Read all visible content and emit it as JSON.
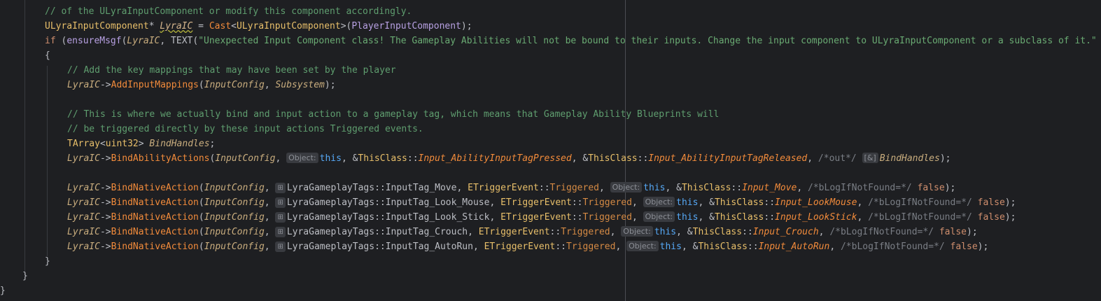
{
  "editor": {
    "theme": "dark"
  },
  "colors": {
    "default": "#bcbec4",
    "keyword": "#cf8e6d",
    "type": "#e8bf6a",
    "macro": "#b8a1e3",
    "string": "#6aab73",
    "comment": "#7a7e85",
    "green_comment": "#5f9e6f",
    "var_italic": "#d4b48c",
    "function": "#f28b3b",
    "param_italic": "#c9ad7e",
    "this": "#56a8f5",
    "enum_member": "#c77dbb",
    "orange": "#d58a44"
  },
  "lines": [
    {
      "indent": 64,
      "tokens": [
        {
          "t": "// of the ULyraInputComponent or modify this component accordingly.",
          "c": "green_comment"
        }
      ]
    },
    {
      "indent": 64,
      "tokens": [
        {
          "t": "ULyraInputComponent",
          "c": "type"
        },
        {
          "t": "* ",
          "c": "default"
        },
        {
          "t": "LyraIC",
          "c": "var_italic",
          "i": true,
          "u": true
        },
        {
          "t": " = ",
          "c": "default"
        },
        {
          "t": "Cast",
          "c": "function"
        },
        {
          "t": "<",
          "c": "default"
        },
        {
          "t": "ULyraInputComponent",
          "c": "type"
        },
        {
          "t": ">(",
          "c": "default"
        },
        {
          "t": "PlayerInputComponent",
          "c": "macro"
        },
        {
          "t": ");",
          "c": "default"
        }
      ]
    },
    {
      "indent": 64,
      "tokens": [
        {
          "t": "if",
          "c": "keyword"
        },
        {
          "t": " (",
          "c": "default"
        },
        {
          "t": "ensureMsgf",
          "c": "macro"
        },
        {
          "t": "(",
          "c": "default"
        },
        {
          "t": "LyraIC",
          "c": "param_italic",
          "i": true
        },
        {
          "t": ", ",
          "c": "default"
        },
        {
          "t": "TEXT",
          "c": "default"
        },
        {
          "t": "(",
          "c": "default"
        },
        {
          "t": "\"Unexpected Input Component class! The Gameplay Abilities will not be bound to their inputs. Change the input component to ULyraInputComponent or a subclass of it.\"",
          "c": "string"
        }
      ]
    },
    {
      "indent": 64,
      "tokens": [
        {
          "t": "{",
          "c": "default"
        }
      ]
    },
    {
      "indent": 96,
      "tokens": [
        {
          "t": "// Add the key mappings that may have been set by the player",
          "c": "green_comment"
        }
      ]
    },
    {
      "indent": 96,
      "tokens": [
        {
          "t": "LyraIC",
          "c": "param_italic",
          "i": true
        },
        {
          "t": "->",
          "c": "default"
        },
        {
          "t": "AddInputMappings",
          "c": "function"
        },
        {
          "t": "(",
          "c": "default"
        },
        {
          "t": "InputConfig",
          "c": "param_italic",
          "i": true
        },
        {
          "t": ", ",
          "c": "default"
        },
        {
          "t": "Subsystem",
          "c": "param_italic",
          "i": true
        },
        {
          "t": ");",
          "c": "default"
        }
      ]
    },
    {
      "indent": 96,
      "tokens": []
    },
    {
      "indent": 96,
      "tokens": [
        {
          "t": "// This is where we actually bind and input action to a gameplay tag, which means that Gameplay Ability Blueprints will",
          "c": "green_comment"
        }
      ]
    },
    {
      "indent": 96,
      "tokens": [
        {
          "t": "// be triggered directly by these input actions Triggered events.",
          "c": "green_comment"
        }
      ]
    },
    {
      "indent": 96,
      "tokens": [
        {
          "t": "TArray",
          "c": "type"
        },
        {
          "t": "<",
          "c": "default"
        },
        {
          "t": "uint32",
          "c": "type"
        },
        {
          "t": "> ",
          "c": "default"
        },
        {
          "t": "BindHandles",
          "c": "param_italic",
          "i": true
        },
        {
          "t": ";",
          "c": "default"
        }
      ]
    },
    {
      "indent": 96,
      "tokens": [
        {
          "t": "LyraIC",
          "c": "param_italic",
          "i": true
        },
        {
          "t": "->",
          "c": "default"
        },
        {
          "t": "BindAbilityActions",
          "c": "function"
        },
        {
          "t": "(",
          "c": "default"
        },
        {
          "t": "InputConfig",
          "c": "param_italic",
          "i": true
        },
        {
          "t": ", ",
          "c": "default"
        },
        {
          "hint": "Object:"
        },
        {
          "t": "this",
          "c": "this"
        },
        {
          "t": ", &",
          "c": "default"
        },
        {
          "t": "ThisClass",
          "c": "type"
        },
        {
          "t": "::",
          "c": "default"
        },
        {
          "t": "Input_AbilityInputTagPressed",
          "c": "function",
          "i": true
        },
        {
          "t": ", &",
          "c": "default"
        },
        {
          "t": "ThisClass",
          "c": "type"
        },
        {
          "t": "::",
          "c": "default"
        },
        {
          "t": "Input_AbilityInputTagReleased",
          "c": "function",
          "i": true
        },
        {
          "t": ", ",
          "c": "default"
        },
        {
          "t": "/*out*/",
          "c": "comment"
        },
        {
          "t": " ",
          "c": "default"
        },
        {
          "hint": "[&]"
        },
        {
          "t": "BindHandles",
          "c": "param_italic",
          "i": true
        },
        {
          "t": ");",
          "c": "default"
        }
      ]
    },
    {
      "indent": 96,
      "tokens": []
    },
    {
      "indent": 96,
      "tokens": [
        {
          "t": "LyraIC",
          "c": "param_italic",
          "i": true
        },
        {
          "t": "->",
          "c": "default"
        },
        {
          "t": "BindNativeAction",
          "c": "function"
        },
        {
          "t": "(",
          "c": "default"
        },
        {
          "t": "InputConfig",
          "c": "param_italic",
          "i": true
        },
        {
          "t": ", ",
          "c": "default"
        },
        {
          "hint": "⊞",
          "icon": true
        },
        {
          "t": "LyraGameplayTags",
          "c": "default"
        },
        {
          "t": "::",
          "c": "default"
        },
        {
          "t": "InputTag_Move",
          "c": "default"
        },
        {
          "t": ", ",
          "c": "default"
        },
        {
          "t": "ETriggerEvent",
          "c": "type"
        },
        {
          "t": "::",
          "c": "default"
        },
        {
          "t": "Triggered",
          "c": "orange"
        },
        {
          "t": ", ",
          "c": "default"
        },
        {
          "hint": "Object:"
        },
        {
          "t": "this",
          "c": "this"
        },
        {
          "t": ", &",
          "c": "default"
        },
        {
          "t": "ThisClass",
          "c": "type"
        },
        {
          "t": "::",
          "c": "default"
        },
        {
          "t": "Input_Move",
          "c": "function",
          "i": true
        },
        {
          "t": ", ",
          "c": "default"
        },
        {
          "t": "/*bLogIfNotFound=*/",
          "c": "comment"
        },
        {
          "t": " ",
          "c": "default"
        },
        {
          "t": "false",
          "c": "keyword"
        },
        {
          "t": ");",
          "c": "default"
        }
      ]
    },
    {
      "indent": 96,
      "tokens": [
        {
          "t": "LyraIC",
          "c": "param_italic",
          "i": true
        },
        {
          "t": "->",
          "c": "default"
        },
        {
          "t": "BindNativeAction",
          "c": "function"
        },
        {
          "t": "(",
          "c": "default"
        },
        {
          "t": "InputConfig",
          "c": "param_italic",
          "i": true
        },
        {
          "t": ", ",
          "c": "default"
        },
        {
          "hint": "⊞",
          "icon": true
        },
        {
          "t": "LyraGameplayTags",
          "c": "default"
        },
        {
          "t": "::",
          "c": "default"
        },
        {
          "t": "InputTag_Look_Mouse",
          "c": "default"
        },
        {
          "t": ", ",
          "c": "default"
        },
        {
          "t": "ETriggerEvent",
          "c": "type"
        },
        {
          "t": "::",
          "c": "default"
        },
        {
          "t": "Triggered",
          "c": "orange"
        },
        {
          "t": ", ",
          "c": "default"
        },
        {
          "hint": "Object:"
        },
        {
          "t": "this",
          "c": "this"
        },
        {
          "t": ", &",
          "c": "default"
        },
        {
          "t": "ThisClass",
          "c": "type"
        },
        {
          "t": "::",
          "c": "default"
        },
        {
          "t": "Input_LookMouse",
          "c": "function",
          "i": true
        },
        {
          "t": ", ",
          "c": "default"
        },
        {
          "t": "/*bLogIfNotFound=*/",
          "c": "comment"
        },
        {
          "t": " ",
          "c": "default"
        },
        {
          "t": "false",
          "c": "keyword"
        },
        {
          "t": ");",
          "c": "default"
        }
      ]
    },
    {
      "indent": 96,
      "tokens": [
        {
          "t": "LyraIC",
          "c": "param_italic",
          "i": true
        },
        {
          "t": "->",
          "c": "default"
        },
        {
          "t": "BindNativeAction",
          "c": "function"
        },
        {
          "t": "(",
          "c": "default"
        },
        {
          "t": "InputConfig",
          "c": "param_italic",
          "i": true
        },
        {
          "t": ", ",
          "c": "default"
        },
        {
          "hint": "⊞",
          "icon": true
        },
        {
          "t": "LyraGameplayTags",
          "c": "default"
        },
        {
          "t": "::",
          "c": "default"
        },
        {
          "t": "InputTag_Look_Stick",
          "c": "default"
        },
        {
          "t": ", ",
          "c": "default"
        },
        {
          "t": "ETriggerEvent",
          "c": "type"
        },
        {
          "t": "::",
          "c": "default"
        },
        {
          "t": "Triggered",
          "c": "orange"
        },
        {
          "t": ", ",
          "c": "default"
        },
        {
          "hint": "Object:"
        },
        {
          "t": "this",
          "c": "this"
        },
        {
          "t": ", &",
          "c": "default"
        },
        {
          "t": "ThisClass",
          "c": "type"
        },
        {
          "t": "::",
          "c": "default"
        },
        {
          "t": "Input_LookStick",
          "c": "function",
          "i": true
        },
        {
          "t": ", ",
          "c": "default"
        },
        {
          "t": "/*bLogIfNotFound=*/",
          "c": "comment"
        },
        {
          "t": " ",
          "c": "default"
        },
        {
          "t": "false",
          "c": "keyword"
        },
        {
          "t": ");",
          "c": "default"
        }
      ]
    },
    {
      "indent": 96,
      "tokens": [
        {
          "t": "LyraIC",
          "c": "param_italic",
          "i": true
        },
        {
          "t": "->",
          "c": "default"
        },
        {
          "t": "BindNativeAction",
          "c": "function"
        },
        {
          "t": "(",
          "c": "default"
        },
        {
          "t": "InputConfig",
          "c": "param_italic",
          "i": true
        },
        {
          "t": ", ",
          "c": "default"
        },
        {
          "hint": "⊞",
          "icon": true
        },
        {
          "t": "LyraGameplayTags",
          "c": "default"
        },
        {
          "t": "::",
          "c": "default"
        },
        {
          "t": "InputTag_Crouch",
          "c": "default"
        },
        {
          "t": ", ",
          "c": "default"
        },
        {
          "t": "ETriggerEvent",
          "c": "type"
        },
        {
          "t": "::",
          "c": "default"
        },
        {
          "t": "Triggered",
          "c": "orange"
        },
        {
          "t": ", ",
          "c": "default"
        },
        {
          "hint": "Object:"
        },
        {
          "t": "this",
          "c": "this"
        },
        {
          "t": ", &",
          "c": "default"
        },
        {
          "t": "ThisClass",
          "c": "type"
        },
        {
          "t": "::",
          "c": "default"
        },
        {
          "t": "Input_Crouch",
          "c": "function",
          "i": true
        },
        {
          "t": ", ",
          "c": "default"
        },
        {
          "t": "/*bLogIfNotFound=*/",
          "c": "comment"
        },
        {
          "t": " ",
          "c": "default"
        },
        {
          "t": "false",
          "c": "keyword"
        },
        {
          "t": ");",
          "c": "default"
        }
      ]
    },
    {
      "indent": 96,
      "tokens": [
        {
          "t": "LyraIC",
          "c": "param_italic",
          "i": true
        },
        {
          "t": "->",
          "c": "default"
        },
        {
          "t": "BindNativeAction",
          "c": "function"
        },
        {
          "t": "(",
          "c": "default"
        },
        {
          "t": "InputConfig",
          "c": "param_italic",
          "i": true
        },
        {
          "t": ", ",
          "c": "default"
        },
        {
          "hint": "⊞",
          "icon": true
        },
        {
          "t": "LyraGameplayTags",
          "c": "default"
        },
        {
          "t": "::",
          "c": "default"
        },
        {
          "t": "InputTag_AutoRun",
          "c": "default"
        },
        {
          "t": ", ",
          "c": "default"
        },
        {
          "t": "ETriggerEvent",
          "c": "type"
        },
        {
          "t": "::",
          "c": "default"
        },
        {
          "t": "Triggered",
          "c": "orange"
        },
        {
          "t": ", ",
          "c": "default"
        },
        {
          "hint": "Object:"
        },
        {
          "t": "this",
          "c": "this"
        },
        {
          "t": ", &",
          "c": "default"
        },
        {
          "t": "ThisClass",
          "c": "type"
        },
        {
          "t": "::",
          "c": "default"
        },
        {
          "t": "Input_AutoRun",
          "c": "function",
          "i": true
        },
        {
          "t": ", ",
          "c": "default"
        },
        {
          "t": "/*bLogIfNotFound=*/",
          "c": "comment"
        },
        {
          "t": " ",
          "c": "default"
        },
        {
          "t": "false",
          "c": "keyword"
        },
        {
          "t": ");",
          "c": "default"
        }
      ]
    },
    {
      "indent": 64,
      "tokens": [
        {
          "t": "}",
          "c": "default"
        }
      ]
    },
    {
      "indent": 32,
      "tokens": [
        {
          "t": "}",
          "c": "default"
        }
      ]
    },
    {
      "indent": 0,
      "tokens": [
        {
          "t": "}",
          "c": "default"
        }
      ]
    }
  ]
}
